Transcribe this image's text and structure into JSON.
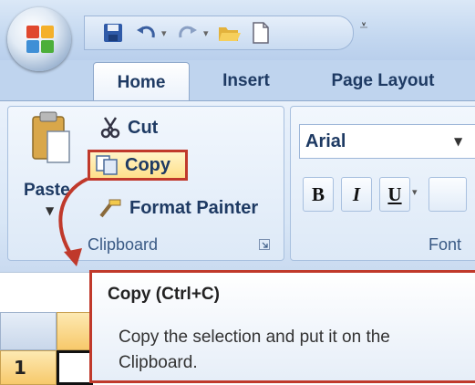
{
  "ribbon": {
    "tabs": [
      {
        "label": "Home",
        "active": true
      },
      {
        "label": "Insert",
        "active": false
      },
      {
        "label": "Page Layout",
        "active": false
      }
    ]
  },
  "clipboard": {
    "paste_label": "Paste",
    "cut_label": "Cut",
    "copy_label": "Copy",
    "format_painter_label": "Format Painter",
    "group_label": "Clipboard"
  },
  "font": {
    "name": "Arial",
    "bold": "B",
    "italic": "I",
    "underline": "U",
    "group_label": "Font"
  },
  "tooltip": {
    "title": "Copy (Ctrl+C)",
    "body": "Copy the selection and put it on the Clipboard."
  },
  "sheet": {
    "row1": "1"
  },
  "colors": {
    "highlight": "#c0392b",
    "ribbon_text": "#1e3a63"
  },
  "icons": [
    "office-logo-icon",
    "save-icon",
    "undo-icon",
    "redo-icon",
    "open-icon",
    "new-document-icon",
    "paste-icon",
    "scissors-icon",
    "copy-icon",
    "format-painter-icon",
    "dialog-launcher-icon",
    "chevron-down-icon"
  ]
}
